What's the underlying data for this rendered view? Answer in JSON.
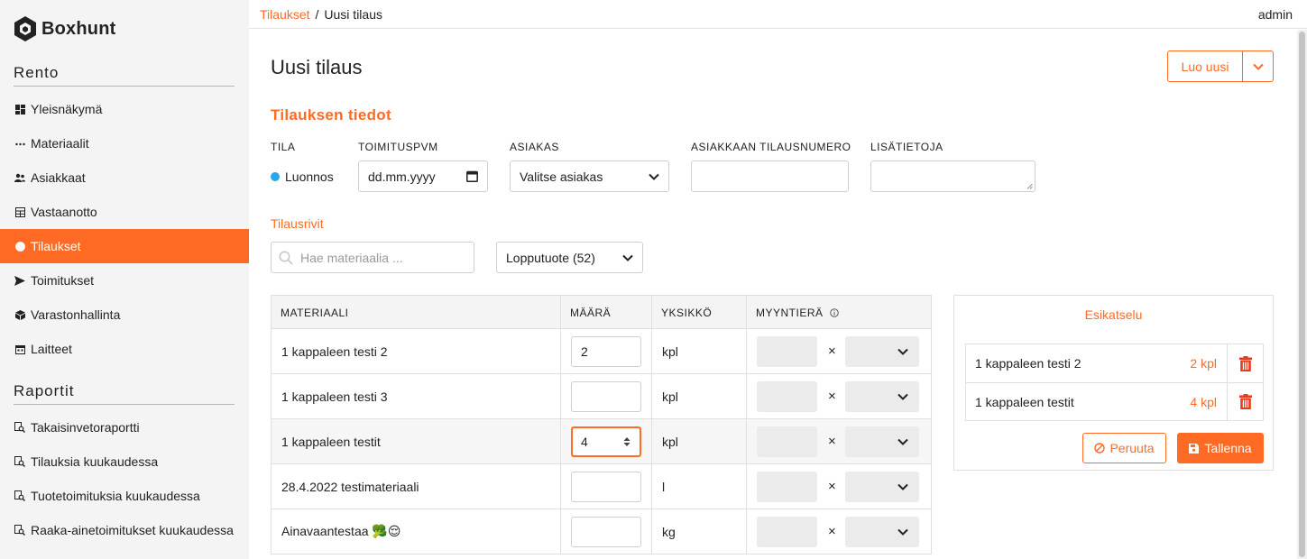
{
  "brand": {
    "name": "Boxhunt",
    "accent": "#ff6b24"
  },
  "sidebar": {
    "section1": "Rento",
    "items": [
      {
        "label": "Yleisnäkymä",
        "icon": "dashboard-icon"
      },
      {
        "label": "Materiaalit",
        "icon": "dots-icon"
      },
      {
        "label": "Asiakkaat",
        "icon": "users-icon"
      },
      {
        "label": "Vastaanotto",
        "icon": "table-icon"
      },
      {
        "label": "Tilaukset",
        "icon": "order-icon",
        "active": true
      },
      {
        "label": "Toimitukset",
        "icon": "send-icon"
      },
      {
        "label": "Varastonhallinta",
        "icon": "box-icon"
      },
      {
        "label": "Laitteet",
        "icon": "calendar-icon"
      }
    ],
    "section2": "Raportit",
    "reports": [
      {
        "label": "Takaisinvetoraportti"
      },
      {
        "label": "Tilauksia kuukaudessa"
      },
      {
        "label": "Tuotetoimituksia kuukaudessa"
      },
      {
        "label": "Raaka-ainetoimitukset kuukaudessa"
      }
    ]
  },
  "topbar": {
    "crumb_link": "Tilaukset",
    "crumb_sep": "/",
    "crumb_current": "Uusi tilaus",
    "user": "admin"
  },
  "page": {
    "title": "Uusi tilaus",
    "create_label": "Luo uusi"
  },
  "details": {
    "heading": "Tilauksen tiedot",
    "labels": {
      "status": "TILA",
      "date": "TOIMITUSPVM",
      "customer": "ASIAKAS",
      "customer_order": "ASIAKKAAN TILAUSNUMERO",
      "notes": "LISÄTIETOJA"
    },
    "status_value": "Luonnos",
    "date_placeholder": "dd.mm.yyyy",
    "customer_value": "Valitse asiakas",
    "customer_order_value": "",
    "notes_value": ""
  },
  "rows_section": {
    "label": "Tilausrivit",
    "search_placeholder": "Hae materiaalia ...",
    "filter_value": "Lopputuote (52)"
  },
  "table": {
    "headers": {
      "material": "MATERIAALI",
      "qty": "MÄÄRÄ",
      "unit": "YKSIKKÖ",
      "batch": "MYYNTIERÄ"
    },
    "times": "×",
    "rows": [
      {
        "material": "1 kappaleen testi 2",
        "qty": "2",
        "unit": "kpl"
      },
      {
        "material": "1 kappaleen testi 3",
        "qty": "",
        "unit": "kpl"
      },
      {
        "material": "1 kappaleen testit",
        "qty": "4",
        "unit": "kpl"
      },
      {
        "material": "28.4.2022 testimateriaali",
        "qty": "",
        "unit": "l"
      },
      {
        "material": "Ainavaantestaa 🥦😌",
        "qty": "",
        "unit": "kg"
      }
    ]
  },
  "preview": {
    "title": "Esikatselu",
    "items": [
      {
        "name": "1 kappaleen testi 2",
        "qty": "2 kpl"
      },
      {
        "name": "1 kappaleen testit",
        "qty": "4 kpl"
      }
    ],
    "cancel_label": "Peruuta",
    "save_label": "Tallenna"
  }
}
